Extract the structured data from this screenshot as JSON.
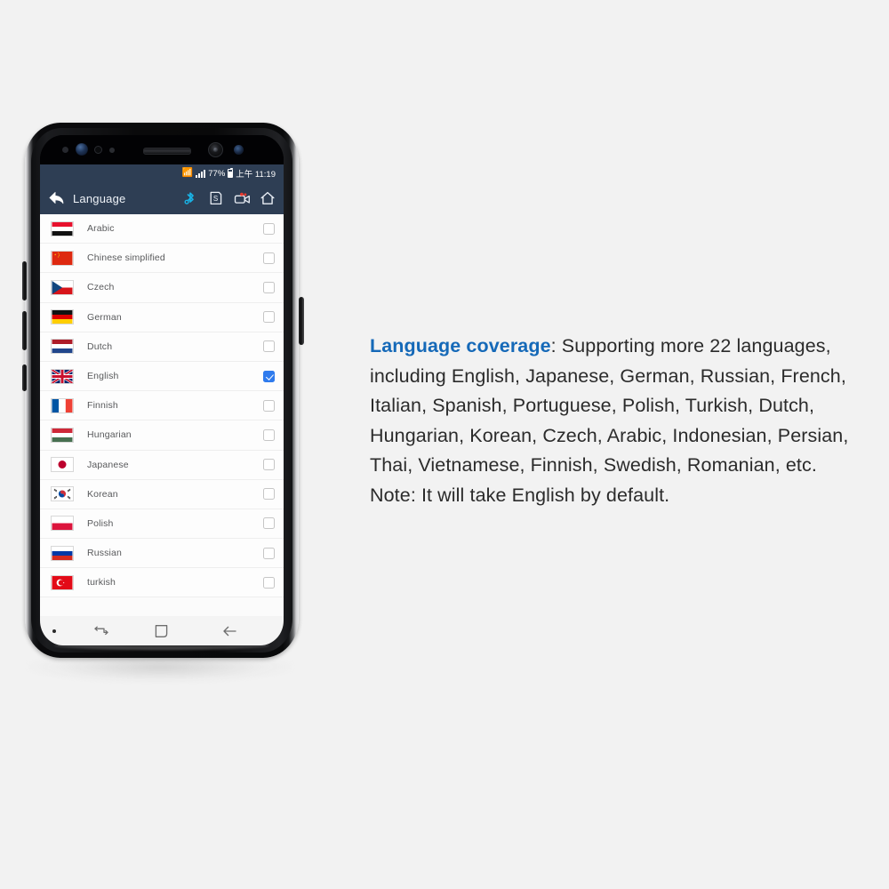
{
  "page": {
    "background_color": "#f2f2f2",
    "accent_color": "#1569b8",
    "checkbox_active_color": "#2f7bed",
    "appbar_color": "#2e3e54"
  },
  "phone": {
    "status_bar": {
      "bluetooth_icon": "bluetooth-icon",
      "signal_icon": "signal-bars-icon",
      "battery_percent": "77%",
      "battery_icon": "battery-icon",
      "time": "上午 11:19"
    },
    "app_bar": {
      "back_icon": "back-arrow-icon",
      "title": "Language",
      "actions": [
        {
          "name": "bluetooth-icon",
          "label": "Bluetooth"
        },
        {
          "name": "screenshot-icon",
          "label": "S"
        },
        {
          "name": "video-record-icon",
          "label": "Record"
        },
        {
          "name": "home-icon",
          "label": "Home"
        }
      ]
    },
    "language_list": [
      {
        "name": "Arabic",
        "flag": "yemen-flag",
        "checked": false
      },
      {
        "name": "Chinese simplified",
        "flag": "china-flag",
        "checked": false
      },
      {
        "name": "Czech",
        "flag": "czech-flag",
        "checked": false
      },
      {
        "name": "German",
        "flag": "germany-flag",
        "checked": false
      },
      {
        "name": "Dutch",
        "flag": "netherlands-flag",
        "checked": false
      },
      {
        "name": "English",
        "flag": "uk-flag",
        "checked": true
      },
      {
        "name": "Finnish",
        "flag": "france-flag",
        "checked": false
      },
      {
        "name": "Hungarian",
        "flag": "hungary-flag",
        "checked": false
      },
      {
        "name": "Japanese",
        "flag": "japan-flag",
        "checked": false
      },
      {
        "name": "Korean",
        "flag": "korea-flag",
        "checked": false
      },
      {
        "name": "Polish",
        "flag": "poland-flag",
        "checked": false
      },
      {
        "name": "Russian",
        "flag": "russia-flag",
        "checked": false
      },
      {
        "name": "turkish",
        "flag": "turkey-flag",
        "checked": false
      }
    ],
    "nav_bar": {
      "dot": "indicator-dot",
      "recents_icon": "recents-icon",
      "home_icon": "home-square-icon",
      "back_icon": "back-arrow-icon"
    }
  },
  "copy": {
    "heading": "Language coverage",
    "body": ": Supporting more 22 languages, including English, Japanese, German, Russian, French, Italian, Spanish, Portuguese, Polish, Turkish, Dutch, Hungarian, Korean, Czech, Arabic, Indonesian, Persian, Thai, Vietnamese, Finnish, Swedish, Romanian, etc.",
    "note": "Note: It will take English by default."
  }
}
